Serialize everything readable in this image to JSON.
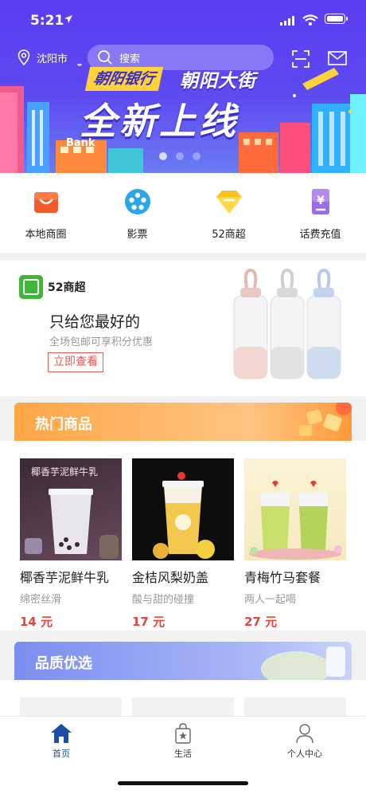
{
  "status_bar": {
    "time": "5:21"
  },
  "header": {
    "city": "沈阳市",
    "search_placeholder": "搜索"
  },
  "banner": {
    "tag": "朝阳银行",
    "subtitle": "朝阳大街",
    "headline": "全新上线",
    "bank_label": "Bank",
    "page_count": 3,
    "active_page": 0
  },
  "categories": [
    {
      "label": "本地商圈",
      "icon": "shopping-bag-icon",
      "color": "#f25a2c"
    },
    {
      "label": "影票",
      "icon": "film-reel-icon",
      "color": "#2aa6ee"
    },
    {
      "label": "52商超",
      "icon": "gem-icon",
      "color": "#f7c21b"
    },
    {
      "label": "话费充值",
      "icon": "yen-phone-icon",
      "color": "#9b6bea"
    }
  ],
  "promo": {
    "brand": "52商超",
    "headline": "只给您最好的",
    "description": "全场包邮可享积分优惠",
    "cta": "立即查看"
  },
  "hot_section": {
    "title": "热门商品",
    "items": [
      {
        "name": "椰香芋泥鲜牛乳",
        "subtitle": "绵密丝滑",
        "price": "14 元",
        "image_text": "椰香芋泥鲜牛乳"
      },
      {
        "name": "金桔风梨奶盖",
        "subtitle": "酸与甜的碰撞",
        "price": "17 元"
      },
      {
        "name": "青梅竹马套餐",
        "subtitle": "两人一起喝",
        "price": "27 元"
      }
    ]
  },
  "quality_section": {
    "title": "品质优选"
  },
  "tabbar": {
    "tabs": [
      {
        "label": "首页",
        "icon": "home-icon",
        "active": true
      },
      {
        "label": "生活",
        "icon": "shopping-bag-star-icon",
        "active": false
      },
      {
        "label": "个人中心",
        "icon": "person-icon",
        "active": false
      }
    ]
  },
  "colors": {
    "primary": "#5a3df2",
    "price": "#e8433a",
    "tab_active": "#1a4fa3"
  }
}
